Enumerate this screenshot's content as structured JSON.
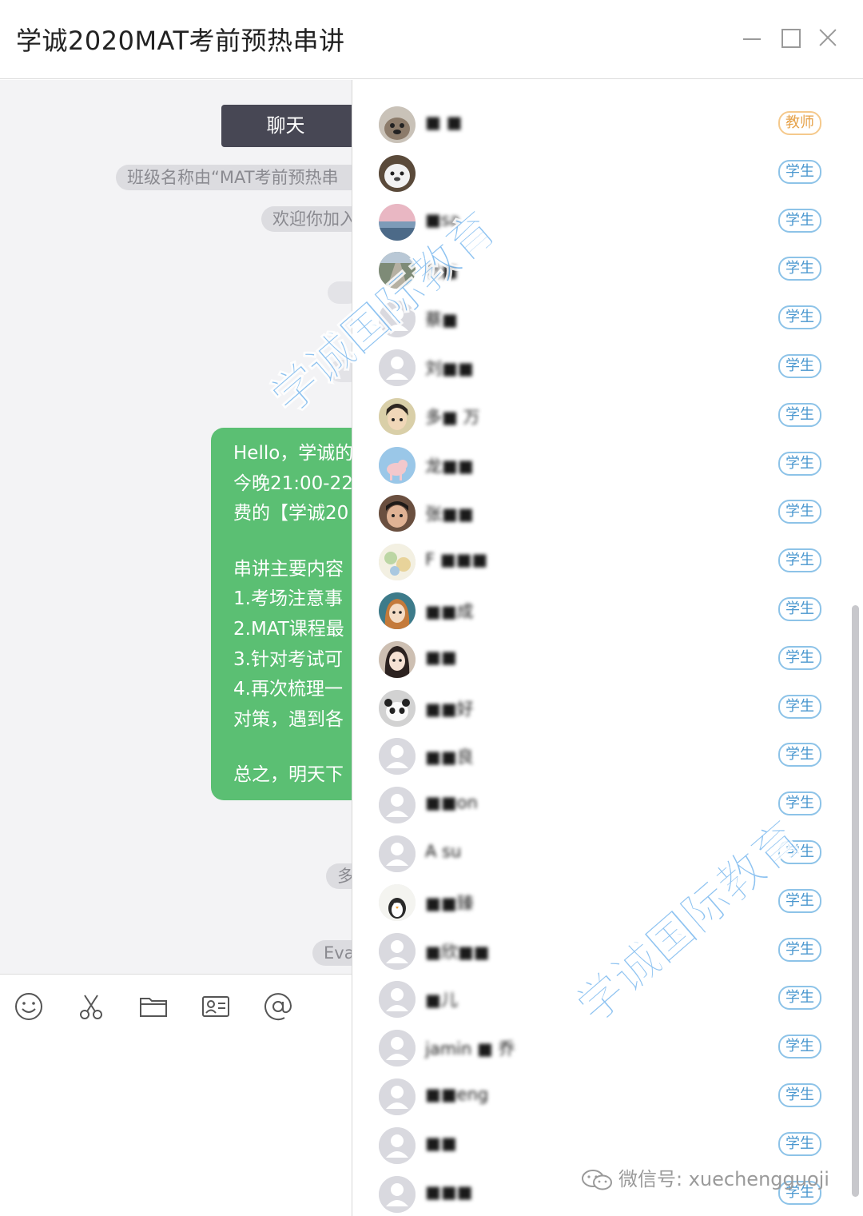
{
  "window": {
    "title": "学诚2020MAT考前预热串讲"
  },
  "chat": {
    "tab_label": "聊天",
    "system_messages": [
      "班级名称由“MAT考前预热串",
      "欢迎你加入",
      "多",
      "Eva"
    ],
    "message_lines": [
      "Hello，学诚的",
      "今晚21:00-22",
      "费的【学诚20",
      "",
      "串讲主要内容",
      "1.考场注意事",
      "2.MAT课程最",
      "3.针对考试可",
      "4.再次梳理一",
      "对策，遇到各",
      "",
      "总之，明天下"
    ]
  },
  "toolbar": {
    "icons": [
      "emoji-icon",
      "scissors-icon",
      "folder-icon",
      "contact-card-icon",
      "at-icon"
    ]
  },
  "members": [
    {
      "name": "■ ■",
      "role": "教师",
      "avatar": "dog"
    },
    {
      "name": "",
      "role": "学生",
      "avatar": "bear"
    },
    {
      "name": "■sa",
      "role": "学生",
      "avatar": "sea"
    },
    {
      "name": "杜■",
      "role": "学生",
      "avatar": "road"
    },
    {
      "name": "蔡■",
      "role": "学生",
      "avatar": "default"
    },
    {
      "name": "刘■■",
      "role": "学生",
      "avatar": "default"
    },
    {
      "name": "多■ 万",
      "role": "学生",
      "avatar": "anime"
    },
    {
      "name": "龙■■",
      "role": "学生",
      "avatar": "pig"
    },
    {
      "name": "张■■",
      "role": "学生",
      "avatar": "boy"
    },
    {
      "name": "F ■■■",
      "role": "学生",
      "avatar": "cartoon"
    },
    {
      "name": "■■成",
      "role": "学生",
      "avatar": "girl"
    },
    {
      "name": "■■",
      "role": "学生",
      "avatar": "woman"
    },
    {
      "name": "■■好",
      "role": "学生",
      "avatar": "panda"
    },
    {
      "name": "■■良",
      "role": "学生",
      "avatar": "default"
    },
    {
      "name": "■■on",
      "role": "学生",
      "avatar": "default"
    },
    {
      "name": "A  su",
      "role": "学生",
      "avatar": "default"
    },
    {
      "name": "■■臻",
      "role": "学生",
      "avatar": "penguin"
    },
    {
      "name": "■欣■■",
      "role": "学生",
      "avatar": "default"
    },
    {
      "name": "■儿",
      "role": "学生",
      "avatar": "default"
    },
    {
      "name": "jamin ■ 乔",
      "role": "学生",
      "avatar": "default"
    },
    {
      "name": "■■eng",
      "role": "学生",
      "avatar": "default"
    },
    {
      "name": "■■",
      "role": "学生",
      "avatar": "default"
    },
    {
      "name": "■■■",
      "role": "学生",
      "avatar": "default"
    }
  ],
  "watermark": {
    "text": "学诚国际教育"
  },
  "footer": {
    "wechat_id": "微信号: xuechengguoji"
  },
  "colors": {
    "bubble": "#5bbf73",
    "tab": "#474754",
    "student_badge": "#4a97cf",
    "teacher_badge": "#e6a24a",
    "watermark": "#7bb9ef"
  }
}
